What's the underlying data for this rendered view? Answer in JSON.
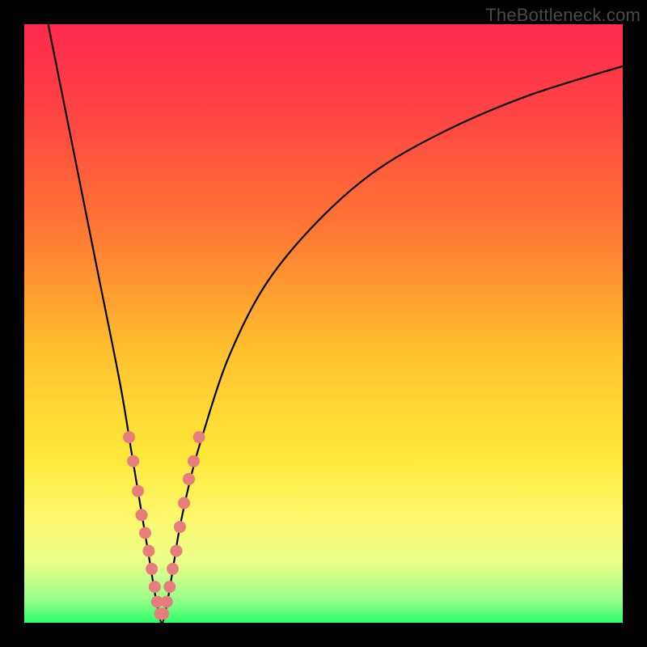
{
  "watermark": "TheBottleneck.com",
  "colors": {
    "frame": "#000000",
    "gradient_stops": [
      {
        "offset": 0.0,
        "color": "#ff2a4d"
      },
      {
        "offset": 0.15,
        "color": "#ff4444"
      },
      {
        "offset": 0.35,
        "color": "#ff7a33"
      },
      {
        "offset": 0.55,
        "color": "#ffc22e"
      },
      {
        "offset": 0.72,
        "color": "#ffe83a"
      },
      {
        "offset": 0.82,
        "color": "#fff76a"
      },
      {
        "offset": 0.9,
        "color": "#e9ff8a"
      },
      {
        "offset": 0.96,
        "color": "#9bff8a"
      },
      {
        "offset": 1.0,
        "color": "#2cff6e"
      }
    ],
    "curve": "#000000",
    "marker_fill": "#e77d7d",
    "marker_stroke": "#c95f5f"
  },
  "chart_data": {
    "type": "line",
    "title": "",
    "xlabel": "",
    "ylabel": "",
    "xlim": [
      0,
      100
    ],
    "ylim": [
      0,
      100
    ],
    "x_min_at": 23,
    "series": [
      {
        "name": "bottleneck-curve",
        "x": [
          4,
          8,
          12,
          16,
          18,
          20,
          21,
          22,
          23,
          24,
          25,
          26,
          28,
          30,
          34,
          40,
          48,
          58,
          70,
          84,
          100
        ],
        "y": [
          100,
          80,
          60,
          40,
          28,
          16,
          10,
          4,
          0,
          4,
          10,
          16,
          25,
          32,
          44,
          56,
          66,
          75,
          82,
          88,
          93
        ]
      }
    ],
    "markers": {
      "name": "highlight-points",
      "x": [
        17.5,
        18.2,
        19.0,
        19.6,
        20.2,
        20.8,
        21.3,
        21.8,
        22.2,
        22.7,
        23.2,
        23.8,
        24.3,
        24.8,
        25.4,
        26.0,
        26.7,
        27.5,
        28.3,
        29.2
      ],
      "y": [
        31,
        27,
        22,
        18,
        15,
        12,
        9,
        6,
        3.5,
        1.5,
        1.5,
        3.5,
        6,
        9,
        12,
        16,
        20,
        24,
        27,
        31
      ]
    }
  }
}
